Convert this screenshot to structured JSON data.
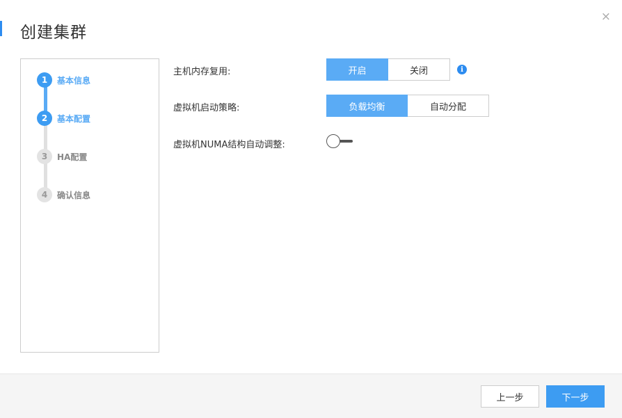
{
  "dialog": {
    "title": "创建集群",
    "close_glyph": "×"
  },
  "steps": [
    {
      "num": "1",
      "label": "基本信息",
      "state": "active"
    },
    {
      "num": "2",
      "label": "基本配置",
      "state": "active"
    },
    {
      "num": "3",
      "label": "HA配置",
      "state": "inactive"
    },
    {
      "num": "4",
      "label": "确认信息",
      "state": "inactive"
    }
  ],
  "form": {
    "memory_reuse": {
      "label": "主机内存复用:",
      "options": [
        "开启",
        "关闭"
      ],
      "selected": "开启"
    },
    "vm_boot_policy": {
      "label": "虚拟机启动策略:",
      "options": [
        "负载均衡",
        "自动分配"
      ],
      "selected": "负载均衡"
    },
    "numa_auto_adjust": {
      "label": "虚拟机NUMA结构自动调整:",
      "enabled": false
    },
    "info_icon": "info-icon"
  },
  "footer": {
    "prev_label": "上一步",
    "next_label": "下一步"
  },
  "colors": {
    "accent": "#3d9cf2",
    "accent_light": "#5aabf5",
    "inactive": "#e3e3e3"
  }
}
